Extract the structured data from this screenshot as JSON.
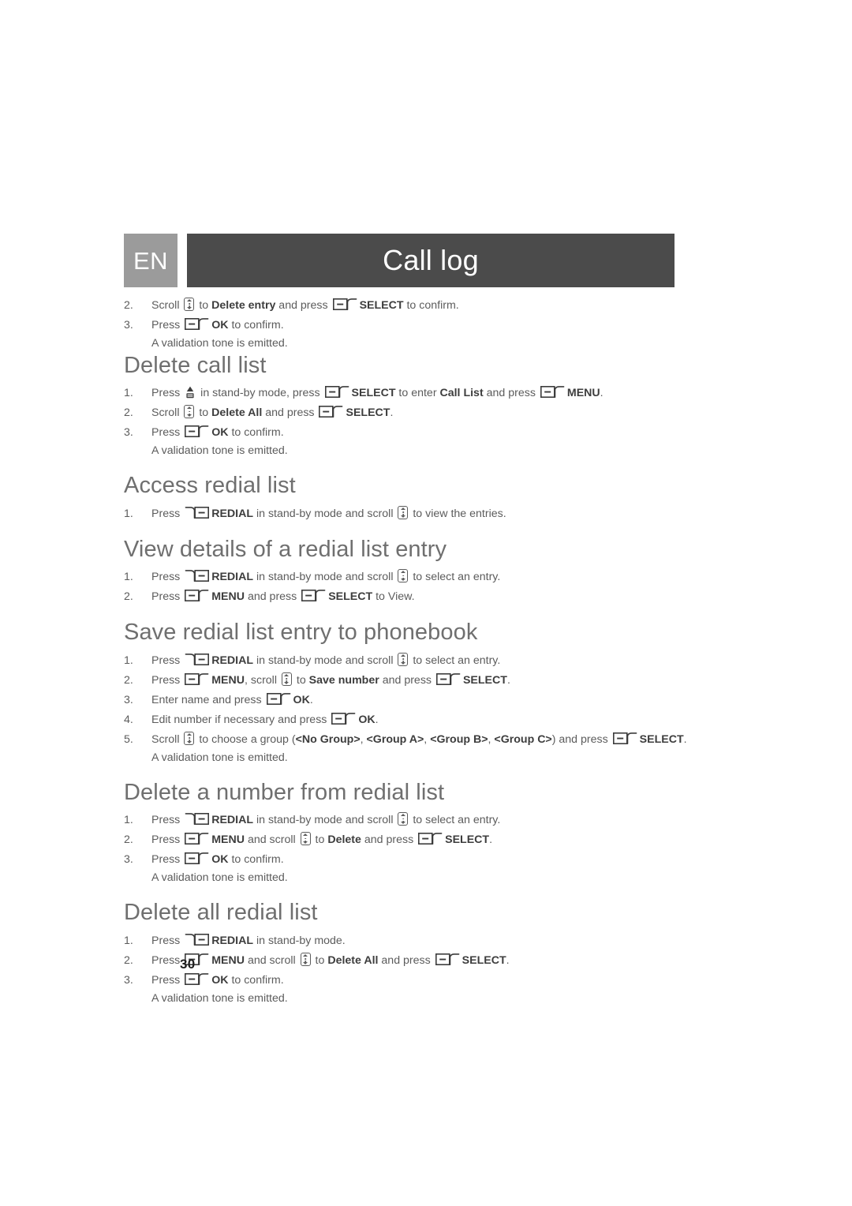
{
  "header": {
    "language_badge": "EN",
    "chapter_title": "Call log"
  },
  "page_number": "30",
  "icons": {
    "scroll": "scroll-updown-icon",
    "softkey_left": "left-softkey-icon",
    "softkey_right": "redial-softkey-icon",
    "call_list": "call-list-key-icon"
  },
  "intro_steps": [
    {
      "num": "2.",
      "parts": [
        {
          "t": "text",
          "v": "Scroll "
        },
        {
          "t": "icon",
          "v": "scroll"
        },
        {
          "t": "text",
          "v": " to "
        },
        {
          "t": "bold",
          "v": "Delete entry"
        },
        {
          "t": "text",
          "v": " and press "
        },
        {
          "t": "icon",
          "v": "softkey_left"
        },
        {
          "t": "bold",
          "v": "SELECT"
        },
        {
          "t": "text",
          "v": " to confirm."
        }
      ]
    },
    {
      "num": "3.",
      "parts": [
        {
          "t": "text",
          "v": "Press "
        },
        {
          "t": "icon",
          "v": "softkey_left"
        },
        {
          "t": "bold",
          "v": "OK"
        },
        {
          "t": "text",
          "v": " to confirm."
        }
      ],
      "sub": "A validation tone is emitted."
    }
  ],
  "sections": [
    {
      "title": "Delete call list",
      "steps": [
        {
          "num": "1.",
          "parts": [
            {
              "t": "text",
              "v": "Press "
            },
            {
              "t": "icon",
              "v": "call_list"
            },
            {
              "t": "text",
              "v": " in stand-by mode, press "
            },
            {
              "t": "icon",
              "v": "softkey_left"
            },
            {
              "t": "bold",
              "v": "SELECT"
            },
            {
              "t": "text",
              "v": " to enter "
            },
            {
              "t": "bold",
              "v": "Call List"
            },
            {
              "t": "text",
              "v": " and press "
            },
            {
              "t": "icon",
              "v": "softkey_left"
            },
            {
              "t": "bold",
              "v": "MENU"
            },
            {
              "t": "text",
              "v": "."
            }
          ]
        },
        {
          "num": "2.",
          "parts": [
            {
              "t": "text",
              "v": "Scroll "
            },
            {
              "t": "icon",
              "v": "scroll"
            },
            {
              "t": "text",
              "v": " to "
            },
            {
              "t": "bold",
              "v": "Delete All"
            },
            {
              "t": "text",
              "v": " and press "
            },
            {
              "t": "icon",
              "v": "softkey_left"
            },
            {
              "t": "bold",
              "v": "SELECT"
            },
            {
              "t": "text",
              "v": "."
            }
          ]
        },
        {
          "num": "3.",
          "parts": [
            {
              "t": "text",
              "v": "Press "
            },
            {
              "t": "icon",
              "v": "softkey_left"
            },
            {
              "t": "bold",
              "v": "OK"
            },
            {
              "t": "text",
              "v": " to confirm."
            }
          ],
          "sub": "A validation tone is emitted."
        }
      ]
    },
    {
      "title": "Access redial list",
      "steps": [
        {
          "num": "1.",
          "parts": [
            {
              "t": "text",
              "v": "Press "
            },
            {
              "t": "icon",
              "v": "softkey_right"
            },
            {
              "t": "bold",
              "v": "REDIAL"
            },
            {
              "t": "text",
              "v": " in stand-by mode and scroll "
            },
            {
              "t": "icon",
              "v": "scroll"
            },
            {
              "t": "text",
              "v": " to view the entries."
            }
          ]
        }
      ]
    },
    {
      "title": "View details of a redial list entry",
      "steps": [
        {
          "num": "1.",
          "parts": [
            {
              "t": "text",
              "v": "Press "
            },
            {
              "t": "icon",
              "v": "softkey_right"
            },
            {
              "t": "bold",
              "v": "REDIAL"
            },
            {
              "t": "text",
              "v": " in stand-by mode and scroll "
            },
            {
              "t": "icon",
              "v": "scroll"
            },
            {
              "t": "text",
              "v": " to select an entry."
            }
          ]
        },
        {
          "num": "2.",
          "parts": [
            {
              "t": "text",
              "v": "Press "
            },
            {
              "t": "icon",
              "v": "softkey_left"
            },
            {
              "t": "bold",
              "v": "MENU"
            },
            {
              "t": "text",
              "v": " and press "
            },
            {
              "t": "icon",
              "v": "softkey_left"
            },
            {
              "t": "bold",
              "v": "SELECT"
            },
            {
              "t": "text",
              "v": " to View."
            }
          ]
        }
      ]
    },
    {
      "title": "Save redial list entry to phonebook",
      "steps": [
        {
          "num": "1.",
          "parts": [
            {
              "t": "text",
              "v": "Press "
            },
            {
              "t": "icon",
              "v": "softkey_right"
            },
            {
              "t": "bold",
              "v": "REDIAL"
            },
            {
              "t": "text",
              "v": " in stand-by mode and scroll "
            },
            {
              "t": "icon",
              "v": "scroll"
            },
            {
              "t": "text",
              "v": " to select an entry."
            }
          ]
        },
        {
          "num": "2.",
          "parts": [
            {
              "t": "text",
              "v": "Press "
            },
            {
              "t": "icon",
              "v": "softkey_left"
            },
            {
              "t": "bold",
              "v": "MENU"
            },
            {
              "t": "text",
              "v": ", scroll "
            },
            {
              "t": "icon",
              "v": "scroll"
            },
            {
              "t": "text",
              "v": " to "
            },
            {
              "t": "bold",
              "v": "Save number"
            },
            {
              "t": "text",
              "v": " and press "
            },
            {
              "t": "icon",
              "v": "softkey_left"
            },
            {
              "t": "bold",
              "v": "SELECT"
            },
            {
              "t": "text",
              "v": "."
            }
          ]
        },
        {
          "num": "3.",
          "parts": [
            {
              "t": "text",
              "v": "Enter name and press "
            },
            {
              "t": "icon",
              "v": "softkey_left"
            },
            {
              "t": "bold",
              "v": "OK"
            },
            {
              "t": "text",
              "v": "."
            }
          ]
        },
        {
          "num": "4.",
          "parts": [
            {
              "t": "text",
              "v": "Edit number if necessary and press "
            },
            {
              "t": "icon",
              "v": "softkey_left"
            },
            {
              "t": "bold",
              "v": "OK"
            },
            {
              "t": "text",
              "v": "."
            }
          ]
        },
        {
          "num": "5.",
          "parts": [
            {
              "t": "text",
              "v": "Scroll "
            },
            {
              "t": "icon",
              "v": "scroll"
            },
            {
              "t": "text",
              "v": " to choose a group ("
            },
            {
              "t": "bold",
              "v": "<No Group>"
            },
            {
              "t": "text",
              "v": ", "
            },
            {
              "t": "bold",
              "v": "<Group A>"
            },
            {
              "t": "text",
              "v": ", "
            },
            {
              "t": "bold",
              "v": "<Group B>"
            },
            {
              "t": "text",
              "v": ", "
            },
            {
              "t": "bold",
              "v": "<Group C>"
            },
            {
              "t": "text",
              "v": ") and press "
            },
            {
              "t": "icon",
              "v": "softkey_left"
            },
            {
              "t": "bold",
              "v": "SELECT"
            },
            {
              "t": "text",
              "v": "."
            }
          ],
          "sub": "A validation tone is emitted."
        }
      ]
    },
    {
      "title": "Delete a number from redial list",
      "steps": [
        {
          "num": "1.",
          "parts": [
            {
              "t": "text",
              "v": "Press "
            },
            {
              "t": "icon",
              "v": "softkey_right"
            },
            {
              "t": "bold",
              "v": "REDIAL"
            },
            {
              "t": "text",
              "v": " in stand-by mode and scroll "
            },
            {
              "t": "icon",
              "v": "scroll"
            },
            {
              "t": "text",
              "v": " to select an entry."
            }
          ]
        },
        {
          "num": "2.",
          "parts": [
            {
              "t": "text",
              "v": "Press "
            },
            {
              "t": "icon",
              "v": "softkey_left"
            },
            {
              "t": "bold",
              "v": "MENU"
            },
            {
              "t": "text",
              "v": " and scroll "
            },
            {
              "t": "icon",
              "v": "scroll"
            },
            {
              "t": "text",
              "v": " to "
            },
            {
              "t": "bold",
              "v": "Delete"
            },
            {
              "t": "text",
              "v": " and press "
            },
            {
              "t": "icon",
              "v": "softkey_left"
            },
            {
              "t": "bold",
              "v": "SELECT"
            },
            {
              "t": "text",
              "v": "."
            }
          ]
        },
        {
          "num": "3.",
          "parts": [
            {
              "t": "text",
              "v": "Press "
            },
            {
              "t": "icon",
              "v": "softkey_left"
            },
            {
              "t": "bold",
              "v": "OK"
            },
            {
              "t": "text",
              "v": " to confirm."
            }
          ],
          "sub": "A validation tone is emitted."
        }
      ]
    },
    {
      "title": "Delete all redial list",
      "steps": [
        {
          "num": "1.",
          "parts": [
            {
              "t": "text",
              "v": "Press "
            },
            {
              "t": "icon",
              "v": "softkey_right"
            },
            {
              "t": "bold",
              "v": "REDIAL"
            },
            {
              "t": "text",
              "v": " in stand-by mode."
            }
          ]
        },
        {
          "num": "2.",
          "parts": [
            {
              "t": "text",
              "v": "Press "
            },
            {
              "t": "icon",
              "v": "softkey_left"
            },
            {
              "t": "bold",
              "v": "MENU"
            },
            {
              "t": "text",
              "v": " and scroll "
            },
            {
              "t": "icon",
              "v": "scroll"
            },
            {
              "t": "text",
              "v": " to "
            },
            {
              "t": "bold",
              "v": "Delete All"
            },
            {
              "t": "text",
              "v": " and press "
            },
            {
              "t": "icon",
              "v": "softkey_left"
            },
            {
              "t": "bold",
              "v": "SELECT"
            },
            {
              "t": "text",
              "v": "."
            }
          ]
        },
        {
          "num": "3.",
          "parts": [
            {
              "t": "text",
              "v": "Press "
            },
            {
              "t": "icon",
              "v": "softkey_left"
            },
            {
              "t": "bold",
              "v": "OK"
            },
            {
              "t": "text",
              "v": " to confirm."
            }
          ],
          "sub": "A validation tone is emitted."
        }
      ]
    }
  ],
  "colors": {
    "lang_badge_bg": "#9b9b9b",
    "title_bar_bg": "#4b4b4b",
    "heading": "#6f6f6f",
    "body": "#5c5c5c",
    "bold": "#3d3d3d"
  }
}
